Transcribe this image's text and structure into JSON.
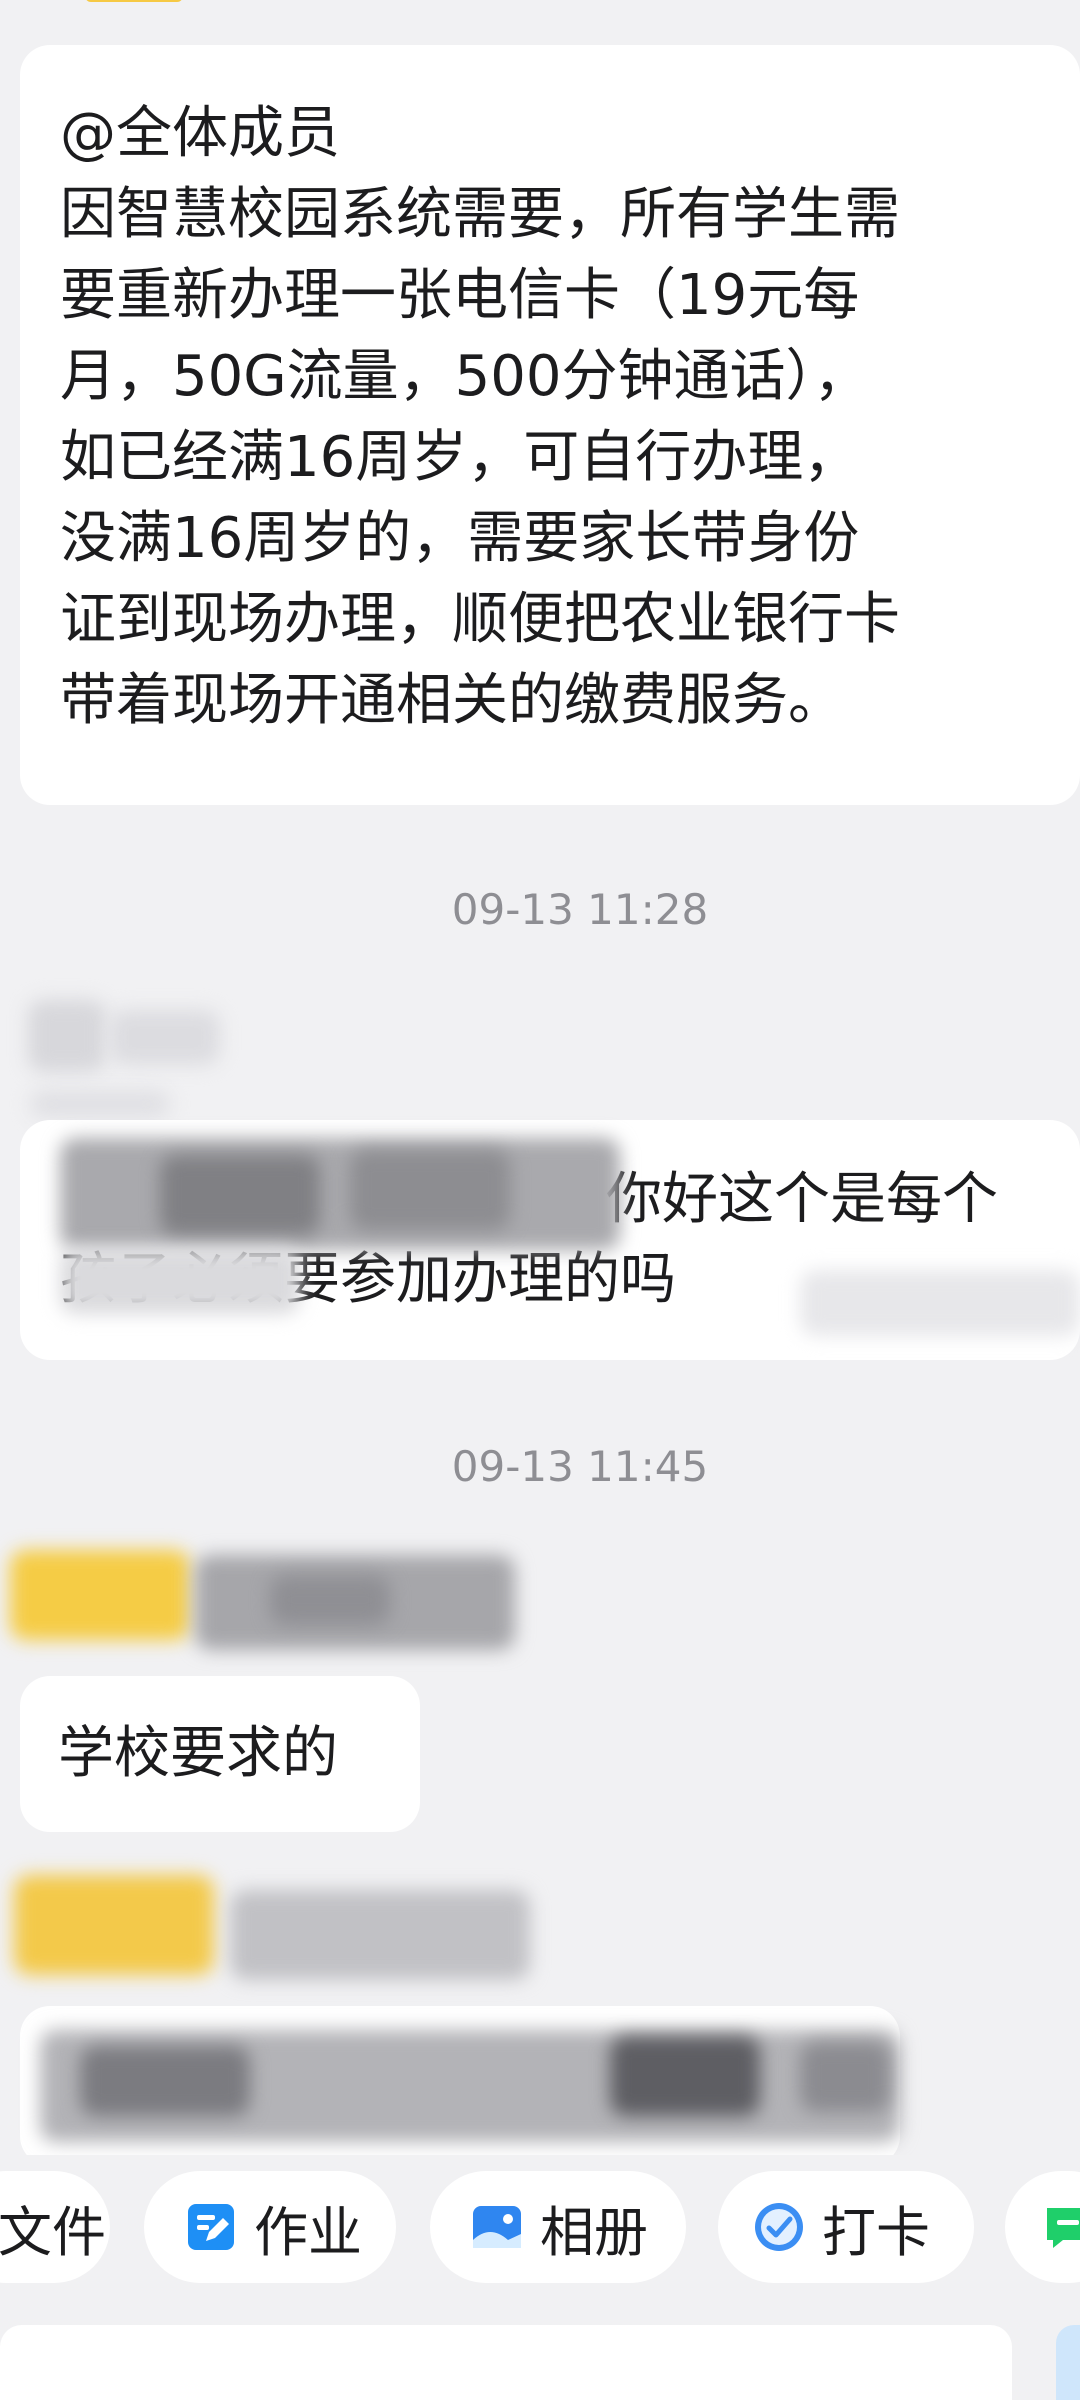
{
  "messages": [
    {
      "mention": "@全体成员",
      "lines": [
        "因智慧校园系统需要，所有学生需",
        "要重新办理一张电信卡（19元每",
        "月，50G流量，500分钟通话），",
        "如已经满16周岁，可自行办理，",
        "没满16周岁的，需要家长带身份",
        "证到现场办理，顺便把农业银行卡",
        "带着现场开通相关的缴费服务。"
      ]
    },
    {
      "timestamp": "09-13 11:28",
      "visible_line_1": "你好这个是每个",
      "visible_line_2": "孩子必须要参加办理的吗"
    },
    {
      "timestamp": "09-13 11:45",
      "text": "学校要求的"
    }
  ],
  "toolbar": {
    "file_label": "文件",
    "homework_label": "作业",
    "album_label": "相册",
    "checkin_label": "打卡"
  },
  "colors": {
    "background": "#f1f1f3",
    "bubble": "#ffffff",
    "timestamp": "#8e8e93",
    "homework_icon": "#1e8ff5",
    "album_icon": "#2f86f0",
    "checkin_icon": "#3b8ef3",
    "more_icon": "#1fcf6a"
  },
  "icons": [
    "document-icon",
    "edit-icon",
    "image-icon",
    "checkin-icon",
    "chat-icon"
  ]
}
